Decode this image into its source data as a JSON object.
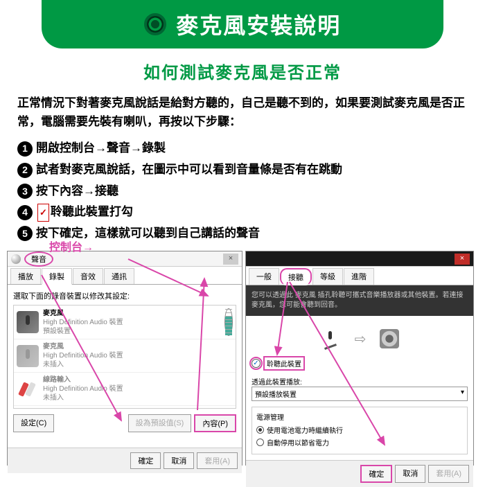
{
  "header": {
    "title": "麥克風安裝說明"
  },
  "subtitle": "如何測試麥克風是否正常",
  "intro": "正常情況下對著麥克風說話是給對方聽的，自己是聽不到的，如果要測試麥克風是否正常，電腦需要先裝有喇叭，再按以下步驟：",
  "steps": [
    "開啟控制台→聲音→錄製",
    "試者對麥克風說話，在圖示中可以看到音量條是否有在跳動",
    "按下內容→接聽",
    "聆聽此裝置打勾",
    "按下確定，這樣就可以聽到自己講話的聲音"
  ],
  "step4_icon_label": "✓",
  "left_dialog": {
    "control_panel_label": "控制台→",
    "title_tab": "聲音",
    "tabs": [
      "播放",
      "錄製",
      "音效",
      "通訊"
    ],
    "active_tab": 1,
    "body_label": "選取下面的錄音裝置以修改其設定:",
    "devices": [
      {
        "name": "麥克風",
        "sub1": "High Definition Audio 裝置",
        "sub2": "預設裝置"
      },
      {
        "name": "麥克風",
        "sub1": "High Definition Audio 裝置",
        "sub2": "未插入"
      },
      {
        "name": "線路輸入",
        "sub1": "High Definition Audio 裝置",
        "sub2": "未插入"
      }
    ],
    "footer_left": "設定(C)",
    "default_btn": "設為預設值(S)",
    "props_btn": "內容(P)",
    "ok": "確定",
    "cancel": "取消",
    "apply": "套用(A)"
  },
  "right_dialog": {
    "tabs": [
      "一般",
      "接聽",
      "等級",
      "進階"
    ],
    "active_tab": 1,
    "hint": "您可以透過此 麥克風 插孔聆聽可攜式音樂播放器或其他裝置。若連接麥克風，您可能會聽到回音。",
    "listen_checkbox": "聆聽此裝置",
    "playback_label": "透過此裝置播放:",
    "playback_value": "預設播放裝置",
    "power_title": "電源管理",
    "power_opt1": "使用電池電力時繼續執行",
    "power_opt2": "自動停用以節省電力",
    "ok": "確定",
    "cancel": "取消",
    "apply": "套用(A)"
  }
}
